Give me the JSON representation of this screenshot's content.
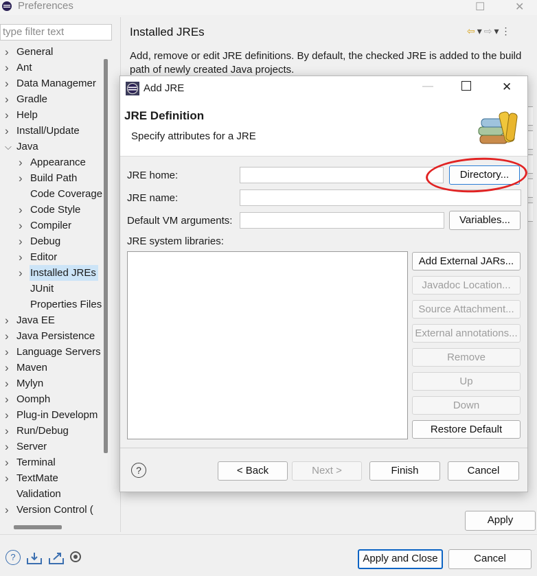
{
  "window": {
    "title": "Preferences"
  },
  "filter": {
    "placeholder": "type filter text"
  },
  "tree": [
    {
      "label": "General",
      "level": 0,
      "expandable": true
    },
    {
      "label": "Ant",
      "level": 0,
      "expandable": true
    },
    {
      "label": "Data Managemer",
      "level": 0,
      "expandable": true
    },
    {
      "label": "Gradle",
      "level": 0,
      "expandable": true
    },
    {
      "label": "Help",
      "level": 0,
      "expandable": true
    },
    {
      "label": "Install/Update",
      "level": 0,
      "expandable": true
    },
    {
      "label": "Java",
      "level": 0,
      "expandable": true,
      "expanded": true
    },
    {
      "label": "Appearance",
      "level": 1,
      "expandable": true
    },
    {
      "label": "Build Path",
      "level": 1,
      "expandable": true
    },
    {
      "label": "Code Coverage",
      "level": 1,
      "expandable": false
    },
    {
      "label": "Code Style",
      "level": 1,
      "expandable": true
    },
    {
      "label": "Compiler",
      "level": 1,
      "expandable": true
    },
    {
      "label": "Debug",
      "level": 1,
      "expandable": true
    },
    {
      "label": "Editor",
      "level": 1,
      "expandable": true
    },
    {
      "label": "Installed JREs",
      "level": 1,
      "expandable": true,
      "selected": true
    },
    {
      "label": "JUnit",
      "level": 1,
      "expandable": false
    },
    {
      "label": "Properties Files",
      "level": 1,
      "expandable": false
    },
    {
      "label": "Java EE",
      "level": 0,
      "expandable": true
    },
    {
      "label": "Java Persistence",
      "level": 0,
      "expandable": true
    },
    {
      "label": "Language Servers",
      "level": 0,
      "expandable": true
    },
    {
      "label": "Maven",
      "level": 0,
      "expandable": true
    },
    {
      "label": "Mylyn",
      "level": 0,
      "expandable": true
    },
    {
      "label": "Oomph",
      "level": 0,
      "expandable": true
    },
    {
      "label": "Plug-in Developm",
      "level": 0,
      "expandable": true
    },
    {
      "label": "Run/Debug",
      "level": 0,
      "expandable": true
    },
    {
      "label": "Server",
      "level": 0,
      "expandable": true
    },
    {
      "label": "Terminal",
      "level": 0,
      "expandable": true
    },
    {
      "label": "TextMate",
      "level": 0,
      "expandable": true
    },
    {
      "label": "Validation",
      "level": 0,
      "expandable": false
    },
    {
      "label": "Version Control (",
      "level": 0,
      "expandable": true
    }
  ],
  "pane": {
    "title": "Installed JREs",
    "description": "Add, remove or edit JRE definitions. By default, the checked JRE is added to the build path of newly created Java projects.",
    "apply_label": "Apply"
  },
  "footer": {
    "apply_close_label": "Apply and Close",
    "cancel_label": "Cancel"
  },
  "dialog": {
    "title": "Add JRE",
    "header_title": "JRE Definition",
    "header_subtitle": "Specify attributes for a JRE",
    "jre_home_label": "JRE home:",
    "jre_home_value": "",
    "directory_button": "Directory...",
    "jre_name_label": "JRE name:",
    "jre_name_value": "",
    "vm_args_label": "Default VM arguments:",
    "vm_args_value": "",
    "variables_button": "Variables...",
    "libs_label": "JRE system libraries:",
    "side_buttons": [
      {
        "label": "Add External JARs...",
        "enabled": true
      },
      {
        "label": "Javadoc Location...",
        "enabled": false
      },
      {
        "label": "Source Attachment...",
        "enabled": false
      },
      {
        "label": "External annotations...",
        "enabled": false
      },
      {
        "label": "Remove",
        "enabled": false
      },
      {
        "label": "Up",
        "enabled": false
      },
      {
        "label": "Down",
        "enabled": false
      },
      {
        "label": "Restore Default",
        "enabled": true
      }
    ],
    "back_button": "< Back",
    "next_button": "Next >",
    "finish_button": "Finish",
    "cancel_button": "Cancel"
  }
}
